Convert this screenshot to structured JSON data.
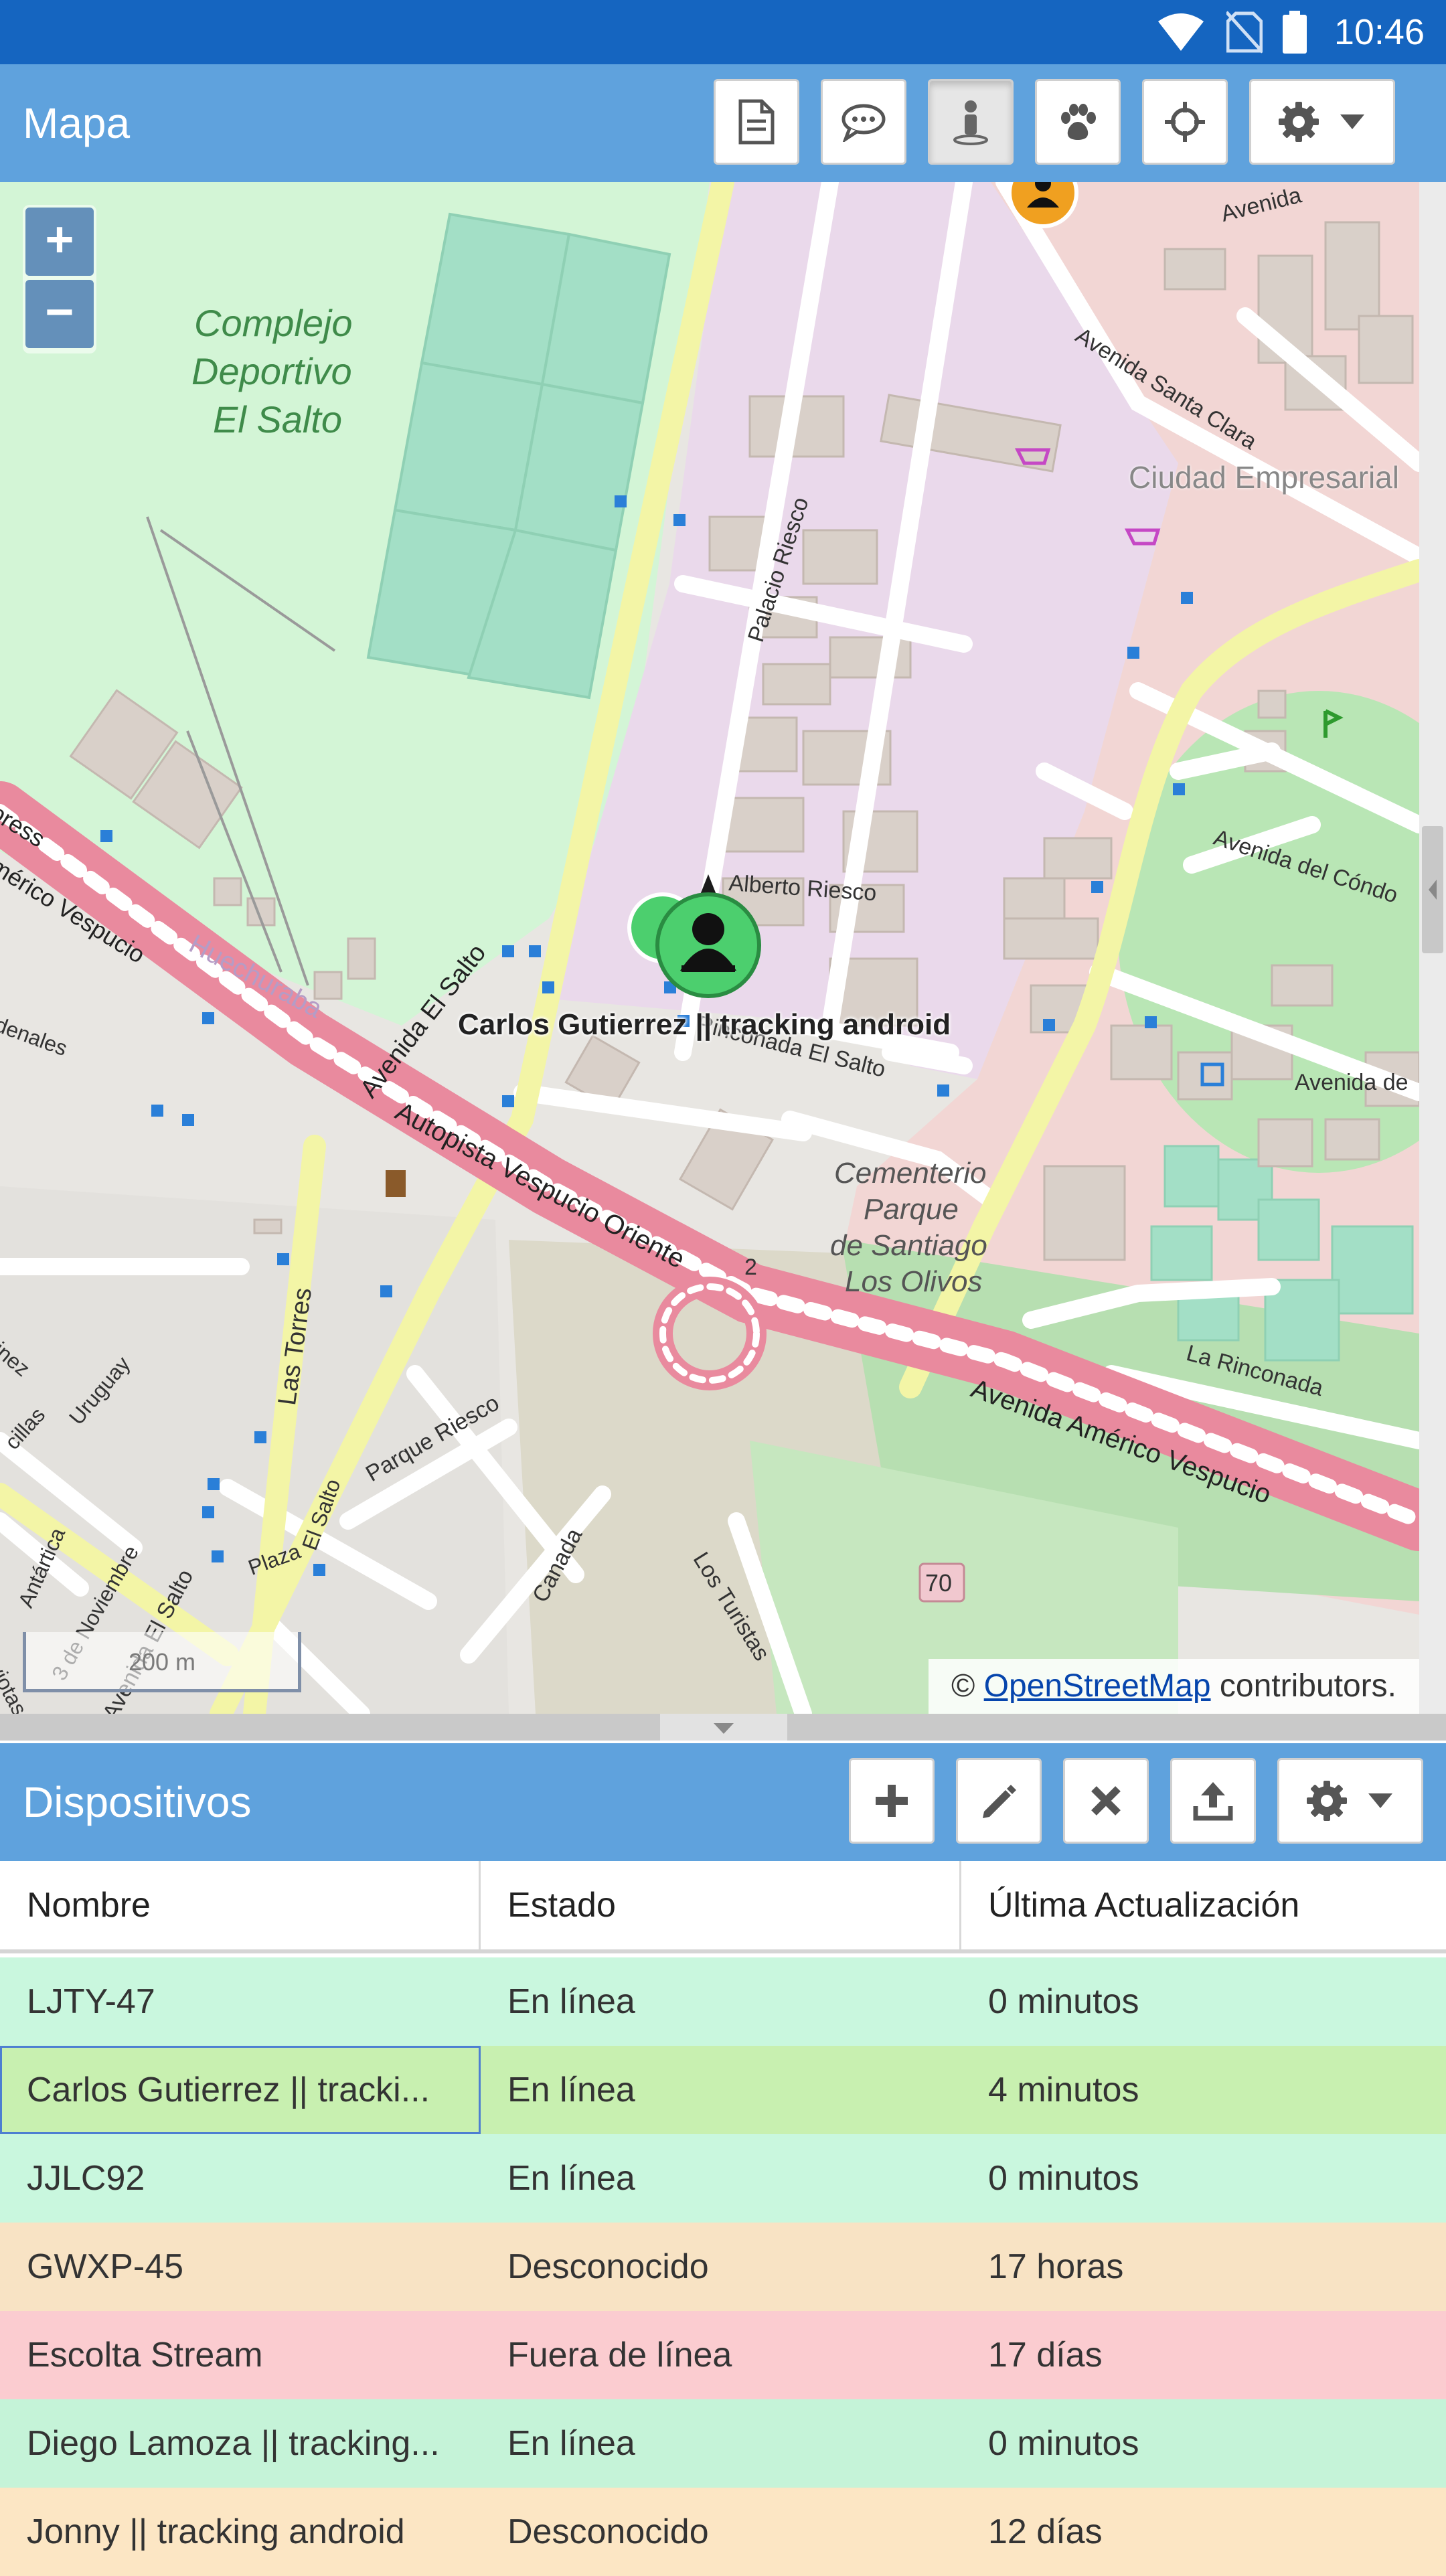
{
  "status_bar": {
    "time": "10:46"
  },
  "map_toolbar": {
    "title": "Mapa",
    "buttons": [
      {
        "icon": "document-icon"
      },
      {
        "icon": "chat-icon"
      },
      {
        "icon": "person-icon",
        "active": true
      },
      {
        "icon": "paw-icon"
      },
      {
        "icon": "crosshair-icon"
      },
      {
        "icon": "gear-icon",
        "dropdown": true
      }
    ]
  },
  "map": {
    "zoom_in": "+",
    "zoom_out": "−",
    "scale": "200 m",
    "attribution_prefix": "©",
    "attribution_link": "OpenStreetMap",
    "attribution_suffix": "contributors.",
    "marker_label": "Carlos Gutierrez || tracking android",
    "labels": {
      "complejo": "Complejo",
      "deportivo": "Deportivo",
      "el_salto_park": "El Salto",
      "ciudad_empresarial": "Ciudad Empresarial",
      "avenida_santa_clara": "Avenida Santa Clara",
      "avenida_top": "Avenida",
      "palacio_riesco": "Palacio Riesco",
      "alberto_riesco": "Alberto Riesco",
      "avenida_del_condor": "Avenida del Cóndo",
      "rinconada_el_salto": "Rinconada El Salto",
      "avenida_de": "Avenida de",
      "cementerio": "Cementerio",
      "parque": "Parque",
      "de_santiago": "de Santiago",
      "los_olivos": "Los Olivos",
      "la_rinconada": "La Rinconada",
      "avenida_americo_vespucio": "Avenida Américo Vespucio",
      "autopista_vespucio_oriente": "Autopista Vespucio Oriente",
      "avenida_el_salto": "Avenida El Salto",
      "huechuraba": "Huechuraba",
      "las_torres": "Las Torres",
      "parque_riesco": "Parque Riesco",
      "canada": "Canada",
      "los_turistas": "Los Turistas",
      "plaza": "Plaza",
      "el_salto_road": "El Salto",
      "avenida_el_salto_2": "Avenida El Salto",
      "tres_de_noviembre": "3 de Noviembre",
      "antartica": "Antártica",
      "aviotas": "aviotas",
      "uruguay": "Uruguay",
      "cillas": "cillas",
      "tinez": "tinez",
      "denales": "denales",
      "merico_vespucio": "mérico Vespucio",
      "press": "press",
      "shield_70": "70",
      "shield_2": "2"
    }
  },
  "devices_toolbar": {
    "title": "Dispositivos",
    "buttons": [
      {
        "icon": "plus-icon"
      },
      {
        "icon": "pencil-icon"
      },
      {
        "icon": "close-icon"
      },
      {
        "icon": "upload-icon"
      },
      {
        "icon": "gear-icon",
        "dropdown": true
      }
    ]
  },
  "devices_table": {
    "headers": [
      "Nombre",
      "Estado",
      "Última Actualización"
    ],
    "rows": [
      {
        "name": "LJTY-47",
        "status": "En línea",
        "updated": "0 minutos",
        "color": "#c9f7de"
      },
      {
        "name": "Carlos Gutierrez || tracki...",
        "status": "En línea",
        "updated": "4 minutos",
        "color": "#c8f0b0"
      },
      {
        "name": "JJLC92",
        "status": "En línea",
        "updated": "0 minutos",
        "color": "#c9f7de"
      },
      {
        "name": "GWXP-45",
        "status": "Desconocido",
        "updated": "17 horas",
        "color": "#f8e3c4"
      },
      {
        "name": "Escolta Stream",
        "status": "Fuera de línea",
        "updated": "17 días",
        "color": "#fbccd0"
      },
      {
        "name": "Diego Lamoza || tracking...",
        "status": "En línea",
        "updated": "0 minutos",
        "color": "#c5f3d8"
      },
      {
        "name": "Jonny || tracking android",
        "status": "Desconocido",
        "updated": "12 días",
        "color": "#fce6c4"
      }
    ]
  }
}
